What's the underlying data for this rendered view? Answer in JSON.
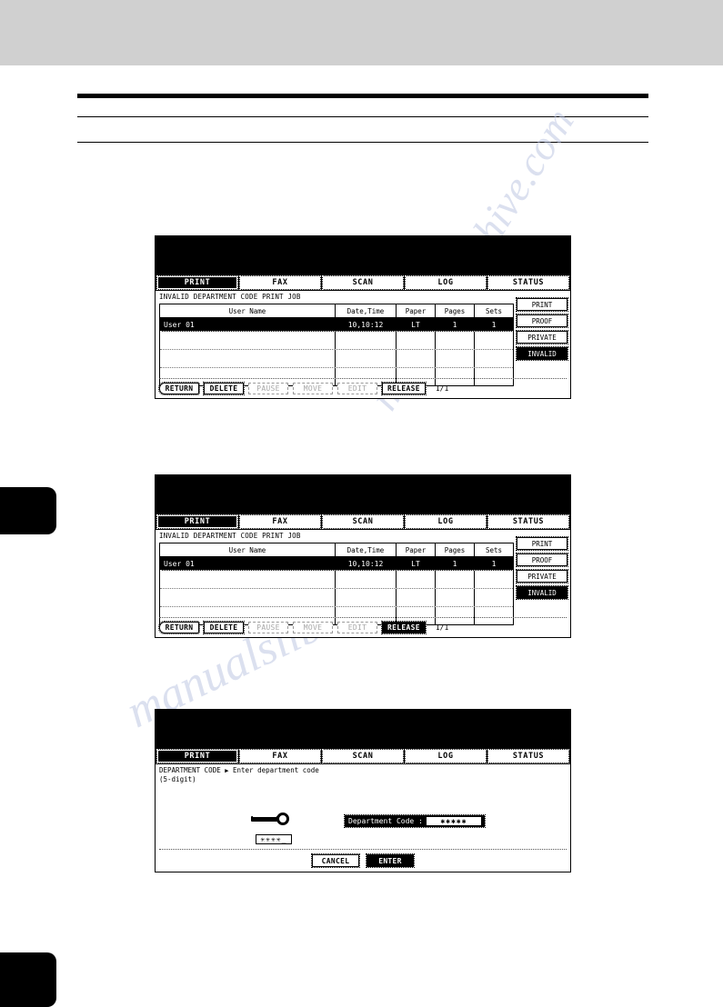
{
  "page": {
    "header_band": "",
    "side_tabs": [
      "",
      ""
    ]
  },
  "watermark": {
    "line1": "manualsarchive.com",
    "line2": "manualslib"
  },
  "panels": [
    {
      "id": "panel-1",
      "tabs": [
        {
          "label": "PRINT",
          "selected": true
        },
        {
          "label": "FAX",
          "selected": false
        },
        {
          "label": "SCAN",
          "selected": false
        },
        {
          "label": "LOG",
          "selected": false
        },
        {
          "label": "STATUS",
          "selected": false
        }
      ],
      "caption": "INVALID DEPARTMENT CODE PRINT JOB",
      "table": {
        "headers": [
          "User Name",
          "Date,Time",
          "Paper",
          "Pages",
          "Sets"
        ],
        "rows": [
          {
            "user": "User 01",
            "date": "10,10:12",
            "paper": "LT",
            "pages": "1",
            "sets": "1",
            "selected": true
          }
        ]
      },
      "side_buttons": [
        {
          "label": "PRINT",
          "selected": false
        },
        {
          "label": "PROOF",
          "selected": false
        },
        {
          "label": "PRIVATE",
          "selected": false
        },
        {
          "label": "INVALID",
          "selected": true
        }
      ],
      "toolbar": [
        {
          "label": "RETURN",
          "state": "normal"
        },
        {
          "label": "DELETE",
          "state": "normal"
        },
        {
          "label": "PAUSE",
          "state": "disabled"
        },
        {
          "label": "MOVE",
          "state": "disabled"
        },
        {
          "label": "EDIT",
          "state": "disabled"
        },
        {
          "label": "RELEASE",
          "state": "normal"
        }
      ],
      "page_indicator": "1/1"
    },
    {
      "id": "panel-2",
      "tabs": [
        {
          "label": "PRINT",
          "selected": true
        },
        {
          "label": "FAX",
          "selected": false
        },
        {
          "label": "SCAN",
          "selected": false
        },
        {
          "label": "LOG",
          "selected": false
        },
        {
          "label": "STATUS",
          "selected": false
        }
      ],
      "caption": "INVALID DEPARTMENT CODE PRINT JOB",
      "table": {
        "headers": [
          "User Name",
          "Date,Time",
          "Paper",
          "Pages",
          "Sets"
        ],
        "rows": [
          {
            "user": "User 01",
            "date": "10,10:12",
            "paper": "LT",
            "pages": "1",
            "sets": "1",
            "selected": true
          }
        ]
      },
      "side_buttons": [
        {
          "label": "PRINT",
          "selected": false
        },
        {
          "label": "PROOF",
          "selected": false
        },
        {
          "label": "PRIVATE",
          "selected": false
        },
        {
          "label": "INVALID",
          "selected": true
        }
      ],
      "toolbar": [
        {
          "label": "RETURN",
          "state": "normal"
        },
        {
          "label": "DELETE",
          "state": "normal"
        },
        {
          "label": "PAUSE",
          "state": "disabled"
        },
        {
          "label": "MOVE",
          "state": "disabled"
        },
        {
          "label": "EDIT",
          "state": "disabled"
        },
        {
          "label": "RELEASE",
          "state": "selected"
        }
      ],
      "page_indicator": "1/1"
    },
    {
      "id": "panel-3",
      "tabs": [
        {
          "label": "PRINT",
          "selected": true
        },
        {
          "label": "FAX",
          "selected": false
        },
        {
          "label": "SCAN",
          "selected": false
        },
        {
          "label": "LOG",
          "selected": false
        },
        {
          "label": "STATUS",
          "selected": false
        }
      ],
      "caption_line1_prefix": "DEPARTMENT CODE",
      "caption_line1_arrow": "▶",
      "caption_line1_text": "Enter department code",
      "caption_line2": "(5-digit)",
      "key_icon_name": "key-icon",
      "key_mask": "✳✳✳✳_",
      "field_label": "Department Code :",
      "field_value": "✱✱✱✱✱",
      "buttons": [
        {
          "label": "CANCEL",
          "state": "normal"
        },
        {
          "label": "ENTER",
          "state": "selected"
        }
      ]
    }
  ]
}
